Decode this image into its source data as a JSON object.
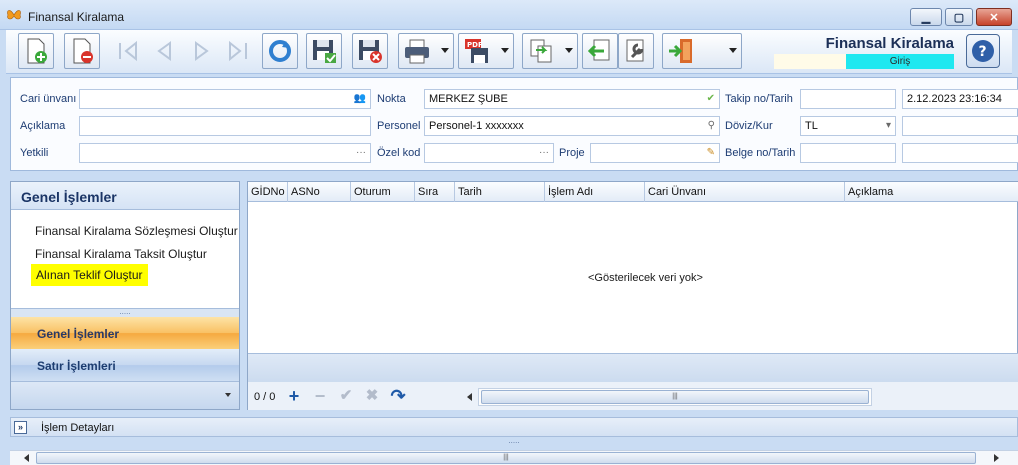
{
  "window": {
    "title": "Finansal Kiralama"
  },
  "toolbar": {
    "buttons": [
      "new-document",
      "delete-document",
      "first-record",
      "previous-record",
      "next-record",
      "last-record",
      "refresh",
      "save",
      "cancel-save",
      "print",
      "pdf-save",
      "copy",
      "import",
      "settings",
      "exit"
    ],
    "brand_title": "Finansal Kiralama",
    "brand_mode": "Giriş",
    "help_label": "?"
  },
  "form": {
    "cari_label": "Cari ünvanı",
    "cari_value": "",
    "aciklama_label": "Açıklama",
    "aciklama_value": "",
    "yetkili_label": "Yetkili",
    "yetkili_value": "",
    "nokta_label": "Nokta",
    "nokta_value": "MERKEZ ŞUBE",
    "personel_label": "Personel",
    "personel_value": "Personel-1 xxxxxxx",
    "ozelkod_label": "Özel kod",
    "ozelkod_value": "",
    "proje_label": "Proje",
    "proje_value": "",
    "takip_label": "Takip no/Tarih",
    "takip_no": "",
    "takip_tarih": "2.12.2023 23:16:34",
    "doviz_label": "Döviz/Kur",
    "doviz_value": "TL",
    "kur_value": "",
    "belge_label": "Belge no/Tarih",
    "belge_no": "",
    "belge_tarih": " .  .       :  :"
  },
  "left_panel": {
    "header": "Genel İşlemler",
    "items": [
      {
        "label": "Finansal Kiralama Sözleşmesi Oluştur"
      },
      {
        "label": "Finansal Kiralama Taksit Oluştur"
      },
      {
        "label": "Alınan Teklif Oluştur"
      }
    ],
    "tabs": [
      {
        "label": "Genel İşlemler"
      },
      {
        "label": "Satır İşlemleri"
      }
    ]
  },
  "grid": {
    "columns": [
      "GİDNo",
      "ASNo",
      "Oturum",
      "Sıra",
      "Tarih",
      "İşlem Adı",
      "Cari Ünvanı",
      "Açıklama"
    ],
    "empty_text": "<Gösterilecek veri yok>",
    "nav_count": "0 / 0"
  },
  "detail": {
    "label": "İşlem Detayları"
  },
  "colors": {
    "accent_active_tab": "#f9c164",
    "highlight": "#ffff00",
    "mode_badge": "#1fe8f0"
  }
}
